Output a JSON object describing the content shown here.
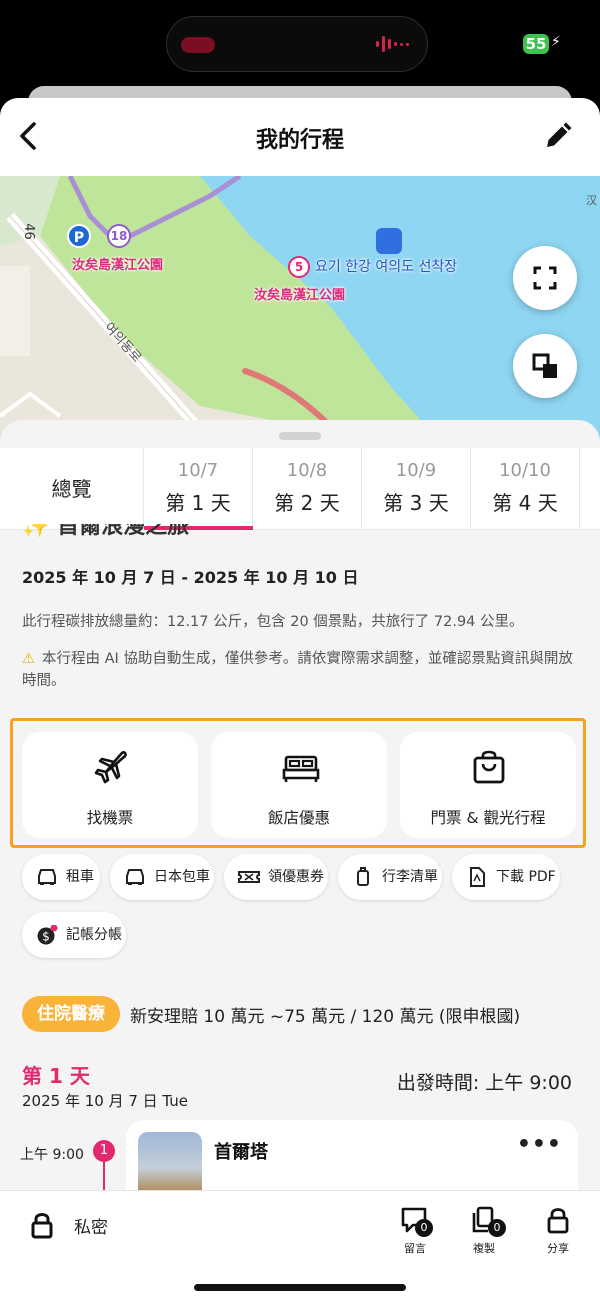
{
  "status": {
    "battery": "55"
  },
  "header": {
    "title": "我的行程"
  },
  "map": {
    "labels": {
      "park1": "汝矣島漢江公園",
      "park2": "汝矣島漢江公園",
      "pier": "요기 한강 여의도 선착장",
      "road": "여의동로",
      "route": "46",
      "corner": "汉",
      "marker_park": "18",
      "marker_pier": "5",
      "parking": "P"
    }
  },
  "tabs": {
    "overview": "總覽",
    "days": [
      {
        "date": "10/7",
        "label": "第 1 天"
      },
      {
        "date": "10/8",
        "label": "第 2 天"
      },
      {
        "date": "10/9",
        "label": "第 3 天"
      },
      {
        "date": "10/10",
        "label": "第 4 天"
      }
    ]
  },
  "trip": {
    "title": "首爾浪漫之旅",
    "dates": "2025 年 10 月 7 日 - 2025 年 10 月 10 日",
    "carbon": "此行程碳排放總量約：12.17 公斤，包含 20 個景點，共旅行了 72.94 公里。",
    "notice": "本行程由 AI 協助自動生成，僅供參考。請依實際需求調整，並確認景點資訊與開放時間。"
  },
  "services": [
    {
      "label": "找機票",
      "icon": "airplane-icon"
    },
    {
      "label": "飯店優惠",
      "icon": "bed-icon"
    },
    {
      "label": "門票 & 觀光行程",
      "icon": "shopping-bag-icon"
    }
  ],
  "chips": [
    {
      "label": "租車",
      "icon": "car-icon"
    },
    {
      "label": "日本包車",
      "icon": "car-icon"
    },
    {
      "label": "領優惠券",
      "icon": "coupon-icon"
    },
    {
      "label": "行李清單",
      "icon": "luggage-icon"
    },
    {
      "label": "下載 PDF",
      "icon": "pdf-icon"
    },
    {
      "label": "記帳分帳",
      "icon": "dollar-icon"
    }
  ],
  "insurance": {
    "badge": "住院醫療",
    "text": "新安理賠 10 萬元 ~75 萬元 / 120 萬元 (限申根國)"
  },
  "itinerary": {
    "day_label": "第 1 天",
    "day_date": "2025 年 10 月 7 日 Tue",
    "depart": "出發時間:  上午 9:00",
    "first_stop": {
      "time": "上午 9:00",
      "number": "1",
      "name": "首爾塔"
    }
  },
  "bottom": {
    "private": "私密",
    "comment": "留言",
    "comment_count": "0",
    "copy": "複製",
    "copy_count": "0",
    "share": "分享"
  }
}
